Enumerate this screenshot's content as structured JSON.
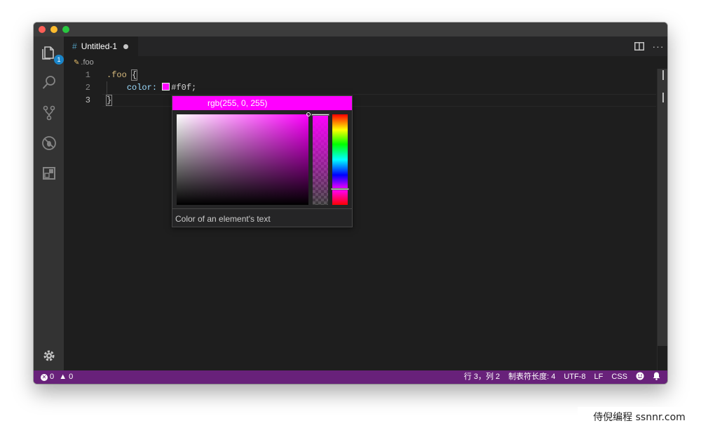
{
  "window": {
    "traffic_lights": [
      "close",
      "minimize",
      "maximize"
    ]
  },
  "activity_bar": {
    "items": [
      {
        "name": "explorer",
        "icon": "files-icon",
        "badge": "1"
      },
      {
        "name": "search",
        "icon": "search-icon"
      },
      {
        "name": "source-control",
        "icon": "source-control-icon"
      },
      {
        "name": "debug",
        "icon": "debug-icon"
      },
      {
        "name": "extensions",
        "icon": "extensions-icon"
      }
    ],
    "settings_icon": "gear-icon"
  },
  "tabs": [
    {
      "icon_glyph": "#",
      "label": "Untitled-1",
      "dirty": true
    }
  ],
  "toolbar": {
    "split_icon": "split-editor-icon",
    "more_label": "···"
  },
  "breadcrumb": {
    "icon_glyph": "✎",
    "label": ".foo"
  },
  "editor": {
    "line_numbers": [
      "1",
      "2",
      "3"
    ],
    "active_line": 3,
    "lines": {
      "l1_selector": ".foo",
      "l1_brace": "{",
      "l2_indent": "    ",
      "l2_property": "color:",
      "l2_value": "#f0f;",
      "l3_brace": "}"
    }
  },
  "color_picker": {
    "header": "rgb(255, 0, 255)",
    "color": "#ff00ff",
    "description": "Color of an element's text"
  },
  "status_bar": {
    "errors": "0",
    "warnings": "0",
    "position": "行 3，列 2",
    "indent": "制表符长度: 4",
    "encoding": "UTF-8",
    "eol": "LF",
    "language": "CSS",
    "background": "#68217a"
  },
  "watermark": "侍倪编程 ssnnr.com"
}
